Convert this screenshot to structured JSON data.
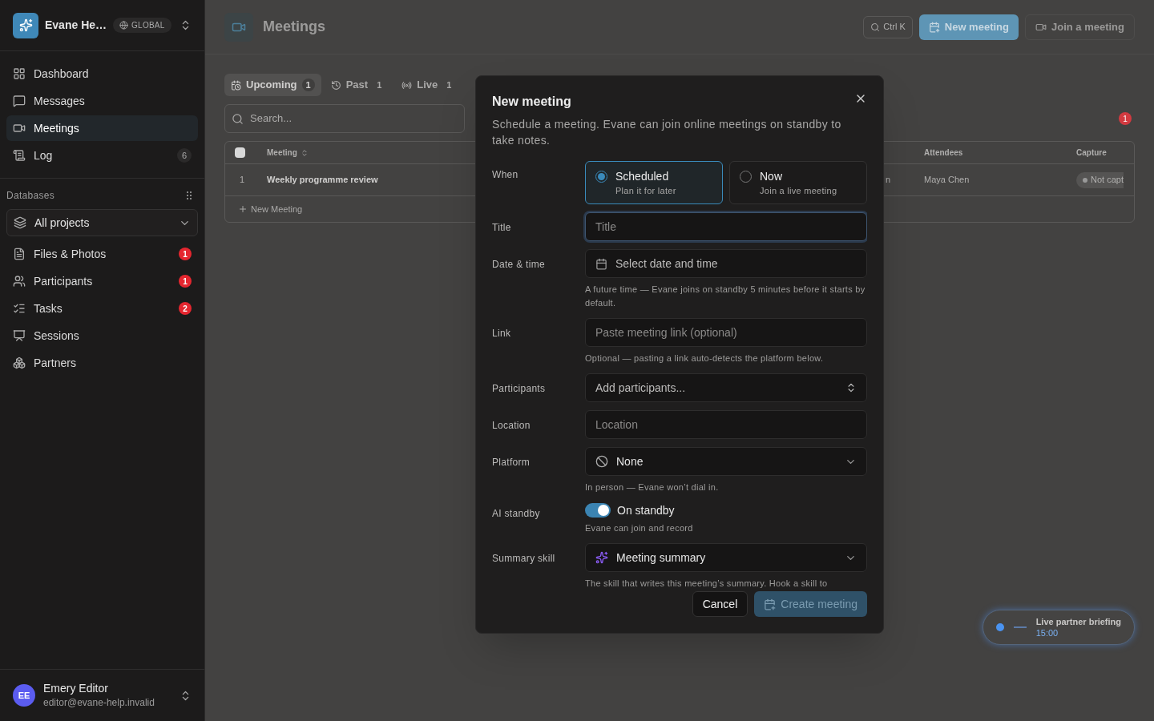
{
  "sidebar": {
    "workspace": {
      "name": "Evane He…",
      "scope": "GLOBAL"
    },
    "nav": [
      {
        "label": "Dashboard",
        "selected": false
      },
      {
        "label": "Messages",
        "selected": false
      },
      {
        "label": "Meetings",
        "selected": true
      },
      {
        "label": "Log",
        "selected": false,
        "count": "6"
      }
    ],
    "section": "Databases",
    "project_select": "All projects",
    "databases": [
      {
        "label": "Files & Photos",
        "badge": "1"
      },
      {
        "label": "Participants",
        "badge": "1"
      },
      {
        "label": "Tasks",
        "badge": "2"
      },
      {
        "label": "Sessions"
      },
      {
        "label": "Partners"
      }
    ],
    "user": {
      "initials": "EE",
      "name": "Emery Editor",
      "email": "editor@evane-help.invalid"
    }
  },
  "main": {
    "title": "Meetings",
    "shortcut": "Ctrl K",
    "buttons": [
      {
        "label": "New meeting",
        "kind": "primary"
      },
      {
        "label": "Join a meeting",
        "kind": "outline"
      }
    ],
    "tabs": [
      {
        "label": "Upcoming",
        "count": "1",
        "selected": true
      },
      {
        "label": "Past",
        "count": "1",
        "selected": false
      },
      {
        "label": "Live",
        "count": "1",
        "selected": false
      }
    ],
    "search": {
      "placeholder": "Search..."
    },
    "alert_badge": "1",
    "table": {
      "all_selected": false,
      "columns": [
        "Meeting",
        "Attendees",
        "Capture"
      ],
      "rows": [
        {
          "index": "1",
          "meeting": "Weekly programme review",
          "column_2": "n",
          "attendees": "Maya Chen",
          "capture": "Not capt"
        }
      ],
      "add_row": "New Meeting"
    },
    "live_pill": {
      "title": "Live partner briefing",
      "time": "15:00"
    }
  },
  "dialog": {
    "title": "New meeting",
    "description": "Schedule a meeting. Evane can join online meetings on standby to take notes.",
    "when": {
      "label": "When",
      "options": [
        {
          "title": "Scheduled",
          "subtitle": "Plan it for later",
          "selected": true
        },
        {
          "title": "Now",
          "subtitle": "Join a live meeting",
          "selected": false
        }
      ]
    },
    "fields": [
      {
        "kind": "input",
        "label": "Title",
        "placeholder": "Title",
        "focused": true
      },
      {
        "kind": "date",
        "label": "Date & time",
        "placeholder": "Select date and time",
        "help": "A future time — Evane joins on standby 5 minutes before it starts by default."
      },
      {
        "kind": "input",
        "label": "Link",
        "placeholder": "Paste meeting link (optional)",
        "help": "Optional — pasting a link auto-detects the platform below."
      },
      {
        "kind": "combobox",
        "label": "Participants",
        "placeholder": "Add participants..."
      },
      {
        "kind": "input",
        "label": "Location",
        "placeholder": "Location"
      },
      {
        "kind": "select",
        "label": "Platform",
        "value": "None",
        "help": "In person — Evane won’t dial in."
      },
      {
        "kind": "toggle",
        "label": "AI standby",
        "value": "On standby",
        "on": true,
        "help": "Evane can join and record"
      },
      {
        "kind": "select",
        "label": "Summary skill",
        "value": "Meeting summary",
        "help": "The skill that writes this meeting’s summary. Hook a skill to"
      }
    ],
    "buttons": [
      {
        "label": "Cancel",
        "kind": "secondary"
      },
      {
        "label": "Create meeting",
        "kind": "primary",
        "disabled": true
      }
    ]
  }
}
